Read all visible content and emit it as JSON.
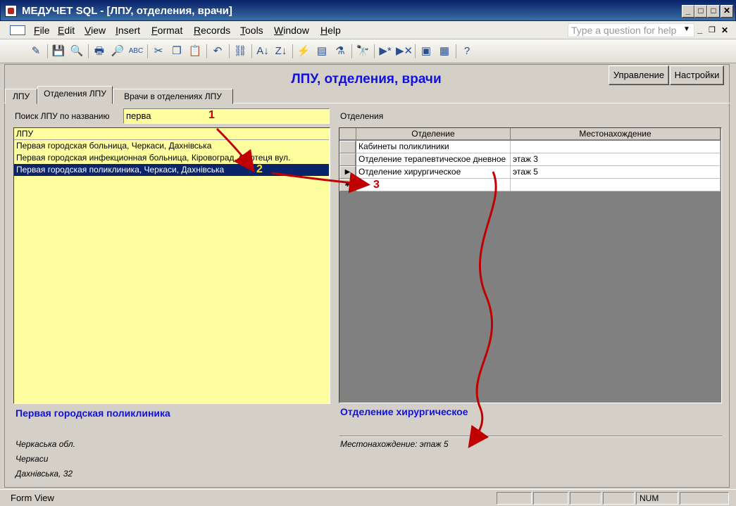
{
  "window": {
    "title": "МЕДУЧЕТ SQL - [ЛПУ, отделения, врачи]",
    "buttons": {
      "minimize": "_",
      "restore": "□",
      "close": "✕"
    }
  },
  "menu": {
    "items": [
      "File",
      "Edit",
      "View",
      "Insert",
      "Format",
      "Records",
      "Tools",
      "Window",
      "Help"
    ],
    "help_placeholder": "Type a question for help",
    "mdi_min": "_",
    "mdi_restore": "❐",
    "mdi_close": "✕"
  },
  "toolbar": {
    "icons": [
      "design-view-icon",
      "save-icon",
      "search-icon",
      "print-icon",
      "print-preview-icon",
      "spelling-icon",
      "cut-icon",
      "copy-icon",
      "paste-icon",
      "undo-icon",
      "hyperlink-icon",
      "sort-ascending-icon",
      "sort-descending-icon",
      "filter-by-selection-icon",
      "filter-by-form-icon",
      "apply-filter-icon",
      "find-icon",
      "new-record-icon",
      "delete-record-icon",
      "properties-icon",
      "database-window-icon",
      "help-icon"
    ],
    "glyphs": [
      "✎",
      "💾",
      "🔍",
      "🖶",
      "🔎",
      "ABC",
      "✂",
      "❐",
      "📋",
      "↶",
      "⛓",
      "A↓",
      "Z↓",
      "⚡",
      "▤",
      "⚗",
      "🔭",
      "▶*",
      "▶✕",
      "▣",
      "▦",
      "?"
    ]
  },
  "form": {
    "title": "ЛПУ, отделения, врачи",
    "buttons": {
      "manage": "Управление",
      "settings": "Настройки"
    },
    "tabs": [
      "ЛПУ",
      "Отделения ЛПУ",
      "Врачи в отделениях ЛПУ"
    ],
    "active_tab": 1
  },
  "search": {
    "label": "Поиск ЛПУ по названию",
    "value": "перва"
  },
  "lpu_list": {
    "header": "ЛПУ",
    "rows": [
      "Первая городская больница, Черкаси, Дахнівська",
      "Первая городская инфекционная больница, Кіровоград, Фортеця вул.",
      "Первая городская поликлиника, Черкаси, Дахнівська"
    ],
    "selected_index": 2
  },
  "departments": {
    "label": "Отделения",
    "columns": [
      "Отделение",
      "Местонахождение"
    ],
    "rows": [
      {
        "name": "Кабинеты поликлиники",
        "location": "",
        "selector": ""
      },
      {
        "name": "Отделение терапевтическое дневное",
        "location": "этаж 3",
        "selector": ""
      },
      {
        "name": "Отделение хирургическое",
        "location": "этаж 5",
        "selector": "▶"
      }
    ],
    "new_row_selector": "✱"
  },
  "details": {
    "lpu_name": "Первая городская поликлиника",
    "address_lines": [
      "Черкаська обл.",
      "Черкаси",
      "Дахнівська, 32"
    ],
    "department_name": "Отделение хирургическое",
    "location_text": "Местонахождение: этаж 5"
  },
  "annotations": {
    "labels": [
      "1",
      "2",
      "3"
    ],
    "arrow_color": "#c00000",
    "label2_color": "#ffe000"
  },
  "status": {
    "mode": "Form View",
    "num": "NUM"
  },
  "colors": {
    "title_blue": "#1010e0",
    "field_yellow": "#ffffa0",
    "selection": "#0a246a"
  }
}
